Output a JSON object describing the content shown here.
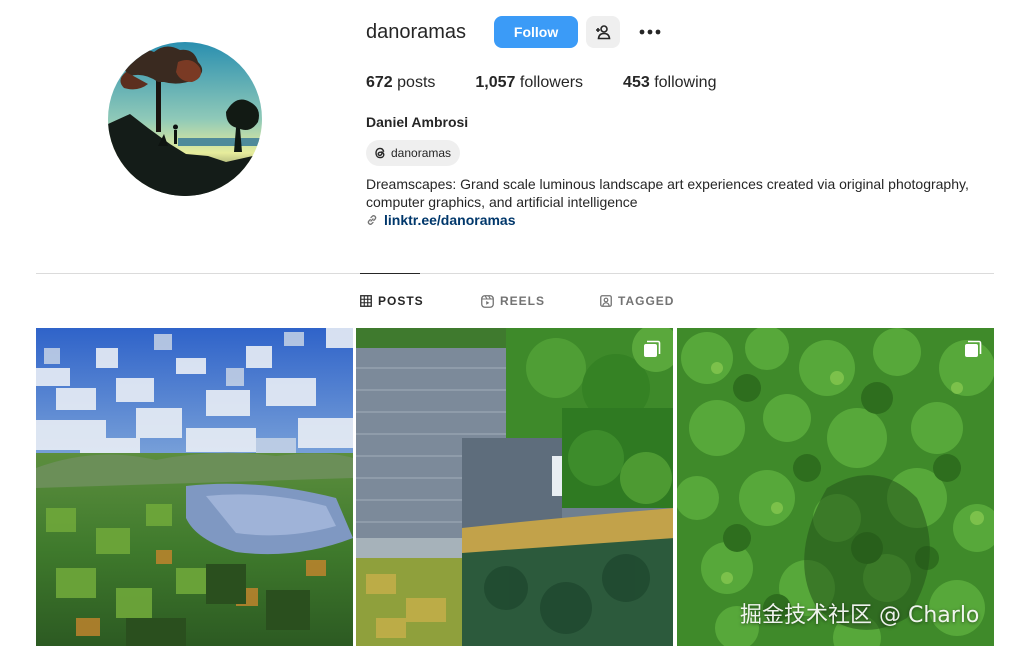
{
  "profile": {
    "username": "danoramas",
    "follow_label": "Follow",
    "full_name": "Daniel Ambrosi",
    "threads_handle": "danoramas",
    "bio": "Dreamscapes: Grand scale luminous landscape art experiences created via original photography, computer graphics, and artificial intelligence",
    "link": "linktr.ee/danoramas"
  },
  "stats": {
    "posts_count": "672",
    "posts_label": "posts",
    "followers_count": "1,057",
    "followers_label": "followers",
    "following_count": "453",
    "following_label": "following"
  },
  "tabs": [
    {
      "label": "POSTS",
      "icon": "grid-icon",
      "active": true
    },
    {
      "label": "REELS",
      "icon": "reels-icon",
      "active": false
    },
    {
      "label": "TAGGED",
      "icon": "tagged-icon",
      "active": false
    }
  ],
  "posts": [
    {
      "multi": false
    },
    {
      "multi": true
    },
    {
      "multi": true
    }
  ],
  "watermark": "掘金技术社区 @ Charlo",
  "colors": {
    "follow_button": "#3b9bf7",
    "link": "#00376b",
    "text": "#262626",
    "muted": "#737373",
    "divider": "#dbdbdb"
  }
}
